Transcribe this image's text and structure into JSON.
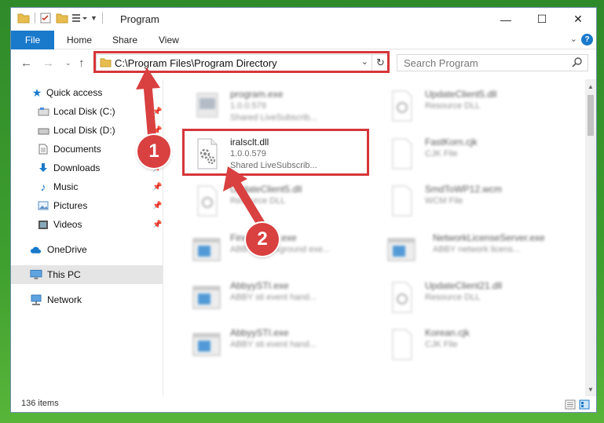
{
  "window": {
    "title": "Program",
    "controls": {
      "minimize": "—",
      "maximize": "☐",
      "close": "✕"
    }
  },
  "ribbon": {
    "file": "File",
    "tabs": [
      "Home",
      "Share",
      "View"
    ],
    "help": "?"
  },
  "navigation": {
    "address": "C:\\Program Files\\Program Directory",
    "search_placeholder": "Search Program"
  },
  "sidebar": {
    "items": [
      {
        "label": "Quick access",
        "icon": "star-icon",
        "pinned": false
      },
      {
        "label": "Local Disk (C:)",
        "icon": "drive-icon",
        "pinned": true
      },
      {
        "label": "Local Disk (D:)",
        "icon": "drive-icon",
        "pinned": true
      },
      {
        "label": "Documents",
        "icon": "documents-icon",
        "pinned": true
      },
      {
        "label": "Downloads",
        "icon": "download-icon",
        "pinned": true
      },
      {
        "label": "Music",
        "icon": "music-icon",
        "pinned": true
      },
      {
        "label": "Pictures",
        "icon": "pictures-icon",
        "pinned": true
      },
      {
        "label": "Videos",
        "icon": "videos-icon",
        "pinned": true
      },
      {
        "label": "OneDrive",
        "icon": "cloud-icon",
        "pinned": false
      },
      {
        "label": "This PC",
        "icon": "computer-icon",
        "pinned": false,
        "selected": true
      },
      {
        "label": "Network",
        "icon": "network-icon",
        "pinned": false
      }
    ]
  },
  "files": {
    "left": [
      {
        "name": "program.exe",
        "line2": "1.0.0.579",
        "line3": "Shared LiveSubscrib...",
        "icon": "exe-icon",
        "blurred": true
      },
      {
        "name": "iralsclt.dll",
        "line2": "1.0.0.579",
        "line3": "Shared LiveSubscrib...",
        "icon": "dll-gear-icon",
        "blurred": false,
        "highlighted": true
      },
      {
        "name": "UpdateClient5.dll",
        "line2": "Resource DLL",
        "icon": "dll-icon",
        "blurred": true
      },
      {
        "name": "FineReader.exe",
        "line2": "ABBYY background exe...",
        "icon": "window-icon",
        "blurred": true
      },
      {
        "name": "AbbyySTI.exe",
        "line2": "ABBY sti event hand...",
        "icon": "window-icon",
        "blurred": true
      },
      {
        "name": "AbbyySTI.exe",
        "line2": "ABBY sti event hand...",
        "icon": "window-icon",
        "blurred": true
      }
    ],
    "right": [
      {
        "name": "UpdateClient5.dll",
        "line2": "Resource DLL",
        "icon": "dll-icon"
      },
      {
        "name": "FastKorn.cjk",
        "line2": "CJK File",
        "icon": "file-icon"
      },
      {
        "name": "SmdToWP12.wcm",
        "line2": "WCM File",
        "icon": "file-icon"
      },
      {
        "name": "NetworkLicenseServer.exe",
        "line2": "ABBY network licens...",
        "icon": "window-icon"
      },
      {
        "name": "UpdateClient21.dll",
        "line2": "Resource DLL",
        "icon": "dll-icon"
      },
      {
        "name": "Korean.cjk",
        "line2": "CJK File",
        "icon": "file-icon"
      }
    ]
  },
  "status": {
    "count": "136 items"
  },
  "callouts": [
    "1",
    "2"
  ],
  "colors": {
    "accent": "#1979ca",
    "highlight": "#d6363a",
    "callout": "#d94040"
  }
}
